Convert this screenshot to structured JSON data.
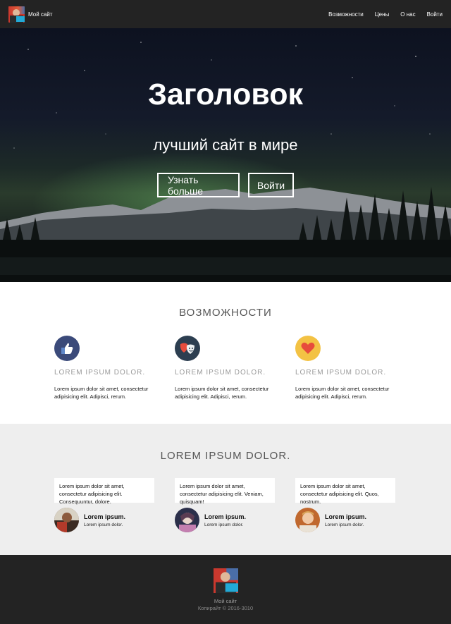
{
  "nav": {
    "brand": "Мой сайт",
    "links": [
      "Возможности",
      "Цены",
      "О нас",
      "Войти"
    ]
  },
  "hero": {
    "title": "Заголовок",
    "subtitle": "лучший сайт в мире",
    "primary_button": "Узнать больше",
    "secondary_button": "Войти"
  },
  "features": {
    "title": "ВОЗМОЖНОСТИ",
    "items": [
      {
        "icon": "thumbs-up-icon",
        "color": "#3b4a7a",
        "heading": "LOREM IPSUM DOLOR.",
        "text": "Lorem ipsum dolor sit amet, consectetur adipisicing elit. Adipisci, rerum."
      },
      {
        "icon": "theater-masks-icon",
        "color": "#2c3e50",
        "heading": "LOREM IPSUM DOLOR.",
        "text": "Lorem ipsum dolor sit amet, consectetur adipisicing elit. Adipisci, rerum."
      },
      {
        "icon": "heart-icon",
        "color": "#f3c244",
        "heading": "LOREM IPSUM DOLOR.",
        "text": "Lorem ipsum dolor sit amet, consectetur adipisicing elit. Adipisci, rerum."
      }
    ]
  },
  "testimonials": {
    "title": "LOREM IPSUM DOLOR.",
    "items": [
      {
        "quote": "Lorem ipsum dolor sit amet, consectetur adipisicing elit. Consequuntur, dolore.",
        "name": "Lorem ipsum.",
        "role": "Lorem ipsum dolor."
      },
      {
        "quote": "Lorem ipsum dolor sit amet, consectetur adipisicing elit. Veniam, quisquam!",
        "name": "Lorem ipsum.",
        "role": "Lorem ipsum dolor."
      },
      {
        "quote": "Lorem ipsum dolor sit amet, consectetur adipisicing elit. Quos, nostrum.",
        "name": "Lorem ipsum.",
        "role": "Lorem ipsum dolor."
      }
    ]
  },
  "footer": {
    "name": "Мой сайт",
    "copyright": "Копирайт © 2016-3010"
  }
}
